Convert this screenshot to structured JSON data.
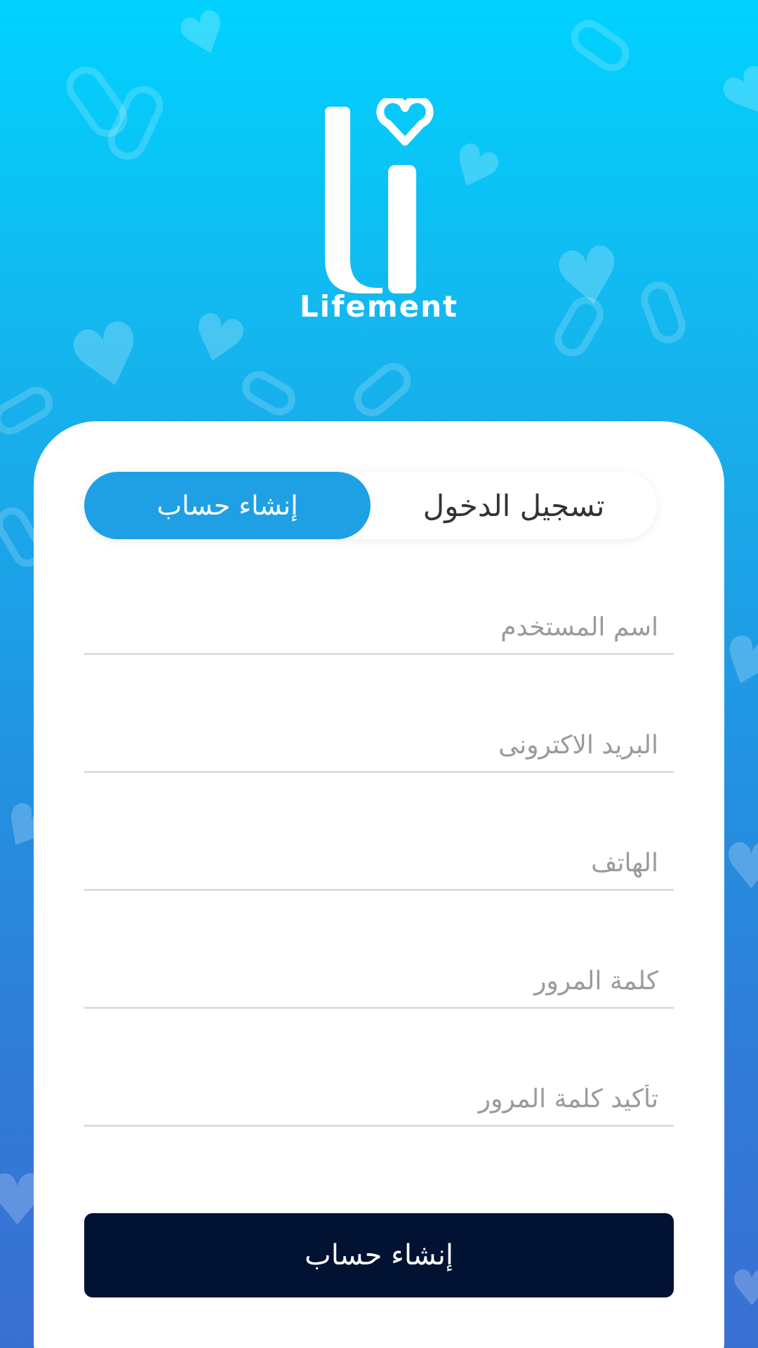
{
  "app": {
    "name": "Lifement"
  },
  "colors": {
    "accent": "#1fa0e4",
    "button_dark": "#021233",
    "background_top": "#00d2ff",
    "background_bottom": "#3a6fd2"
  },
  "tabs": [
    {
      "label": "تسجيل الدخول",
      "active": false
    },
    {
      "label": "إنشاء حساب",
      "active": true
    }
  ],
  "form": {
    "fields": [
      {
        "placeholder": "اسم المستخدم",
        "value": ""
      },
      {
        "placeholder": "البريد الاكترونى",
        "value": ""
      },
      {
        "placeholder": "الهاتف",
        "value": ""
      },
      {
        "placeholder": "كلمة المرور",
        "value": ""
      },
      {
        "placeholder": "تأكيد كلمة المرور",
        "value": ""
      }
    ],
    "submit_label": "إنشاء حساب"
  },
  "icons": {
    "logo": "lifement-heart-logo",
    "background": [
      "heart-icon",
      "pill-icon"
    ]
  }
}
